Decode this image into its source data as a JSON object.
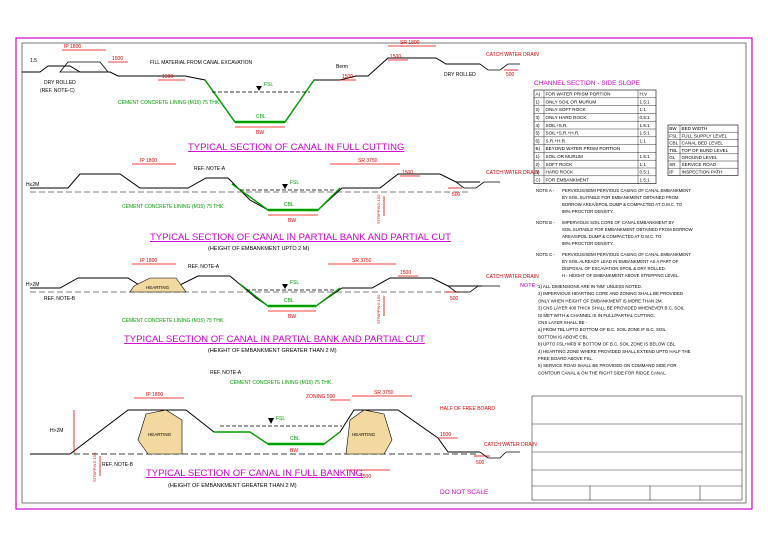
{
  "colors": {
    "border": "#d000d0",
    "dimension": "#e60000",
    "lining": "#00a000",
    "outline": "#000000",
    "hearting": "#f2d9a0"
  },
  "sections": [
    {
      "title": "TYPICAL SECTION OF CANAL IN FULL CUTTING",
      "subtitle": "",
      "labels": {
        "ip": "IP 1800",
        "fill_note": "FILL MATERIAL FROM CANAL EXCAVATION",
        "dry_rolled_left": "DRY ROLLED",
        "ref_note": "(REF. NOTE-C)",
        "berm": "Berm",
        "sr": "SR 1800",
        "catch_drain": "CATCH WATER DRAIN",
        "dry_rolled_right": "DRY ROLLED",
        "lining": "CEMENT CONCRETE LINING (M15) 75 THK.",
        "fsl": "FSL",
        "cbl": "CBL",
        "bw": "BW",
        "d1500a": "1500",
        "d1500b": "1500",
        "d1500c": "1500",
        "d1500d": "1500",
        "d500": "500",
        "s15": "1.5"
      }
    },
    {
      "title": "TYPICAL SECTION OF CANAL IN PARTIAL BANK AND PARTIAL CUT",
      "subtitle": "(HEIGHT OF EMBANKMENT UPTO 2 M)",
      "labels": {
        "ip": "IP 1800",
        "ref_note": "REF. NOTE-A",
        "h": "H≤2M",
        "sr": "SR 3750",
        "catch_drain": "CATCH WATER DRAIN",
        "lining": "CEMENT CONCRETE LINING (M15) 75 THK.",
        "stripping": "STRIPPING 150",
        "fsl": "FSL",
        "cbl": "CBL",
        "bw": "BW",
        "d1500": "1500",
        "d500": "500"
      }
    },
    {
      "title": "TYPICAL SECTION OF CANAL IN PARTIAL BANK AND PARTIAL CUT",
      "subtitle": "(HEIGHT OF EMBANKMENT GREATER THAN 2 M)",
      "labels": {
        "ip": "IP 1800",
        "ref_note": "REF. NOTE-A",
        "h": "H>2M",
        "hearting": "HEARTING",
        "ref_note_b": "REF. NOTE-B",
        "sr": "SR 3750",
        "catch_drain": "CATCH WATER DRAIN",
        "lining": "CEMENT CONCRETE LINING (M15) 75 THK.",
        "stripping": "STRIPPING 150",
        "fsl": "FSL",
        "cbl": "CBL",
        "bw": "BW",
        "d1500": "1500",
        "d500": "500"
      }
    },
    {
      "title": "TYPICAL SECTION OF CANAL IN FULL BANKING",
      "subtitle": "(HEIGHT OF EMBANKMENT GREATER THAN 2 M)",
      "labels": {
        "ref_note_a": "REF. NOTE-A",
        "lining": "CEMENT CONCRETE LINING (M15) 75 THK.",
        "ip": "IP 1800",
        "h": "H>2M",
        "hearting_left": "HEARTING",
        "hearting_right": "HEARTING",
        "zoning": "ZONING 500",
        "sr": "SR 3750",
        "half_free_board": "HALF OF FREE BOARD",
        "catch_drain": "CATCH WATER DRAIN",
        "ref_note_b": "REF. NOTE-B",
        "stripping": "STRIPPING 150",
        "fsl": "FSL",
        "cbl": "CBL",
        "bw": "BW",
        "d2500": "2500",
        "d1500": "1500",
        "d500": "500"
      }
    }
  ],
  "side_slope": {
    "title": "CHANNEL SECTION - SIDE SLOPE",
    "header": [
      "A",
      "FOR WATER PRISM PORTION",
      "H:V"
    ],
    "rows": [
      [
        "A)",
        "FOR WATER PRISM PORTION",
        "H:V"
      ],
      [
        "1)",
        "ONLY SOIL OR MURUM",
        "1.5:1"
      ],
      [
        "2)",
        "ONLY SOFT ROCK",
        "1:1"
      ],
      [
        "3)",
        "ONLY HARD ROCK",
        "0.5:1"
      ],
      [
        "4)",
        "SOIL+S.R.",
        "1.5:1"
      ],
      [
        "5)",
        "SOIL+S.R.+H.R.",
        "1.5:1"
      ],
      [
        "6)",
        "S.R.+H.R.",
        "1:1"
      ],
      [
        "B)",
        "BEYOND WATER PRISM PORTION",
        ""
      ],
      [
        "1)",
        "SOIL OR MURUM",
        "1.5:1"
      ],
      [
        "2)",
        "SOFT ROCK",
        "1:1"
      ],
      [
        "3)",
        "HARD ROCK",
        "0.5:1"
      ],
      [
        "C)",
        "FOR EMBANKMENT",
        "1.5:1"
      ]
    ]
  },
  "abbreviations": [
    [
      "BW",
      "BED WIDTH"
    ],
    [
      "FSL",
      "FULL SUPPLY LEVEL"
    ],
    [
      "CBL",
      "CANAL BED LEVEL"
    ],
    [
      "TBL",
      "TOP OF BUND LEVEL"
    ],
    [
      "GL",
      "GROUND LEVEL"
    ],
    [
      "SR",
      "SERVICE ROAD"
    ],
    [
      "IP",
      "INSPECTION PATH"
    ]
  ],
  "notes_abc": [
    {
      "label": "NOTE A -",
      "lines": [
        "PERVIOUS/SEMI PERVIOUS CASING OF CANAL EMBANKMENT",
        "BY SOIL SUITABLE FOR EMBANKMENT OBTAINED FROM",
        "BORROW AREA/SPOIL DUMP & COMPACTED AT O.M.C. TO",
        "98% PROCTOR DENSITY."
      ]
    },
    {
      "label": "NOTE B -",
      "lines": [
        "IMPERVIOUS SOIL CORE OF CANAL EMBANKMENT BY",
        "SOIL SUITABLE FOR EMBANKMENT OBTAINED FROM BORROW",
        "AREA/SPOIL DUMP & COMPACTED AT O.M.C. TO",
        "98% PROCTOR DENSITY."
      ]
    },
    {
      "label": "NOTE C -",
      "lines": [
        "PERVIOUS/SEMI PERVIOUS CASING OF CANAL EMBANKMENT",
        "BY SOIL ALREADY LEAD IN EMBANKMENT AS A PART OF",
        "DISPOSAL OF EXCAVATION SPOIL & DRY ROLLED.",
        "H - HEIGHT OF EMBANKMENT ABOVE STRIPPING LEVEL."
      ]
    }
  ],
  "notes_label": "NOTE:-",
  "notes": [
    "1) ALL DIMENSIONS ARE IN 'MM' UNLESS NOTED.",
    "2) IMPERVIOUS HEARTING CORE AND ZONING SHALL BE PROVIDED",
    "    ONLY WHEN HEIGHT OF EMBANKMENT IS MORE THAN 2M.",
    "3) CNS LAYER 400 THICK SHALL BE PROVIDED WHENEVER B.C. SOIL",
    "    IS MET WITH & CHANNEL IS IN FULL/PARTIAL CUTTING.",
    "    CNS LAYER SHALL BE -",
    "    a) FROM TBL UPTO BOTTOM OF B.C. SOIL ZONE IF B.C. SOIL",
    "        BOTTOM IS ABOVE CBL",
    "    b) UPTO FSL+MFB IF BOTTOM OF B.C. SOIL ZONE IS BELOW CBL.",
    "4) HEARTING ZONE WHERE PROVIDED SHALL EXTEND UPTO HALF THE",
    "    FREE BOARD ABOVE FSL.",
    "5) SERVICE ROAD SHALL BE PROVIDED ON COMMAND SIDE FOR",
    "    CONTOUR CANAL & ON THE RIGHT SIDE FOR RIDGE CANAL."
  ],
  "do_not_scale": "DO NOT SCALE"
}
